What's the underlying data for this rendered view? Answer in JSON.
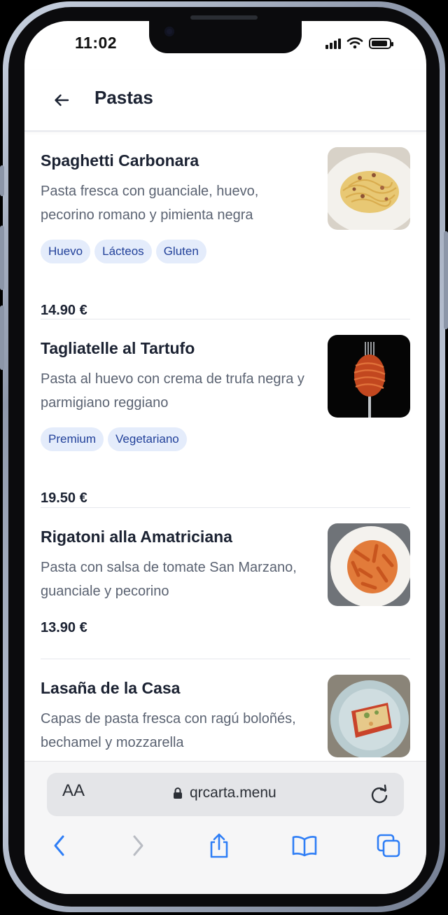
{
  "status_bar": {
    "time": "11:02",
    "battery_level": 0.9
  },
  "header": {
    "title": "Pastas",
    "back_icon": "arrow-left-icon"
  },
  "menu": {
    "items": [
      {
        "name": "Spaghetti Carbonara",
        "description": "Pasta fresca con guanciale, huevo, pecorino romano y pimienta negra",
        "tags": [
          "Huevo",
          "Lácteos",
          "Gluten"
        ],
        "price": "14.90 €",
        "image": "spaghetti-carbonara-photo"
      },
      {
        "name": "Tagliatelle al Tartufo",
        "description": "Pasta al huevo con crema de trufa negra y parmigiano reggiano",
        "tags": [
          "Premium",
          "Vegetariano"
        ],
        "price": "19.50 €",
        "image": "tagliatelle-fork-photo"
      },
      {
        "name": "Rigatoni alla Amatriciana",
        "description": "Pasta con salsa de tomate San Marzano, guanciale y pecorino",
        "tags": [],
        "price": "13.90 €",
        "image": "rigatoni-plate-photo"
      },
      {
        "name": "Lasaña de la Casa",
        "description": "Capas de pasta fresca con ragú boloñés, bechamel y mozzarella",
        "tags": [],
        "price": "",
        "image": "lasagna-plate-photo"
      }
    ]
  },
  "browser": {
    "text_size_label": "AA",
    "url": "qrcarta.menu",
    "icons": [
      "lock-icon",
      "reload-icon",
      "back-chevron-icon",
      "forward-chevron-icon",
      "share-icon",
      "bookmarks-icon",
      "tabs-icon"
    ],
    "accent_color": "#2f7ef6",
    "disabled_color": "#b9bcc3"
  },
  "colors": {
    "tag_bg": "#e4ecfb",
    "tag_text": "#22419a",
    "title_text": "#1b2232",
    "desc_text": "#5b6372"
  }
}
